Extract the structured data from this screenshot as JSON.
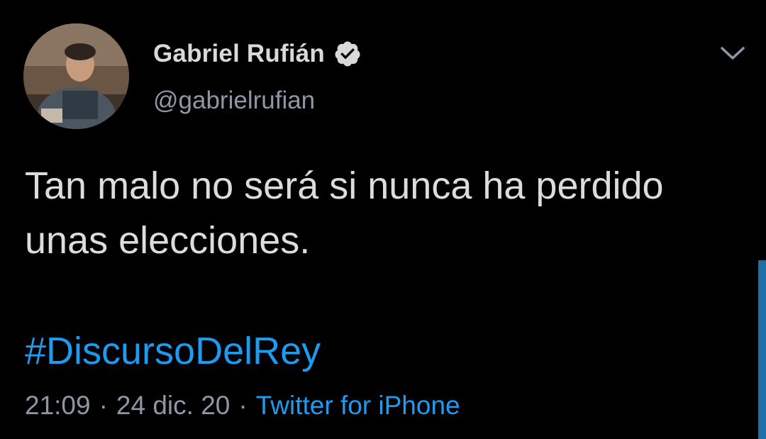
{
  "author": {
    "display_name": "Gabriel Rufián",
    "handle": "@gabrielrufian",
    "verified_icon": "verified-badge-icon",
    "avatar_icon": "avatar"
  },
  "tweet": {
    "text": "Tan malo no será si nunca ha perdido\nunas elecciones.",
    "hashtag": "#DiscursoDelRey"
  },
  "meta": {
    "time": "21:09",
    "separator": "·",
    "date": "24 dic. 20",
    "source": "Twitter for iPhone"
  },
  "menu": {
    "icon": "chevron-down-icon"
  },
  "colors": {
    "background": "#000000",
    "text": "#d9d9d9",
    "muted": "#8b98a5",
    "link": "#1d9bf0"
  }
}
